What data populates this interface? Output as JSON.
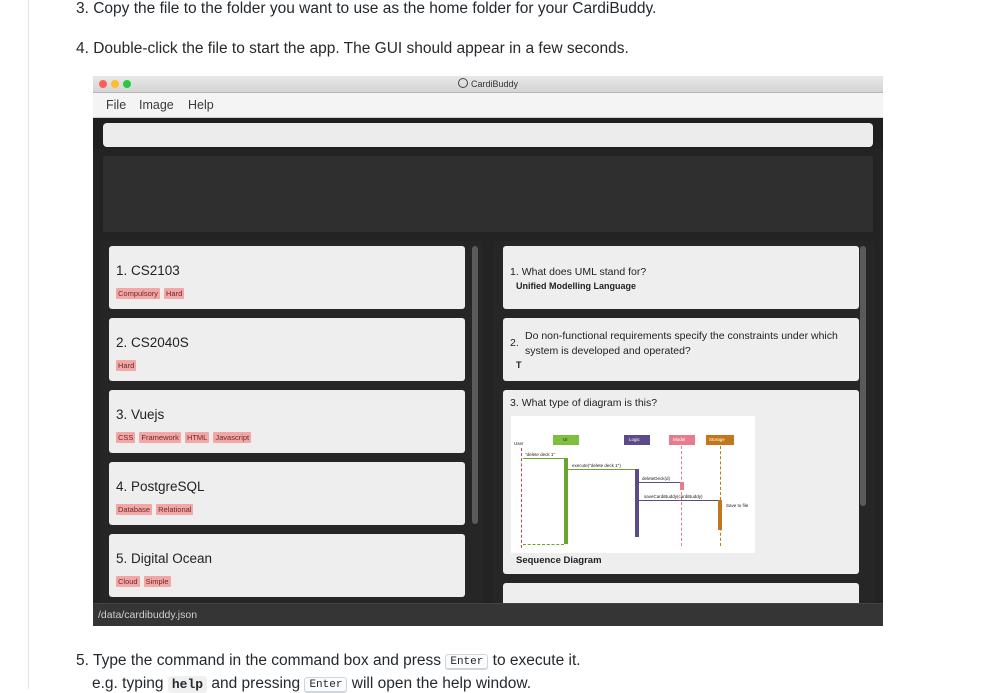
{
  "doc": {
    "step3": "3. Copy the file to the folder you want to use as the home folder for your CardiBuddy.",
    "step4": "4. Double-click the file to start the app. The GUI should appear in a few seconds.",
    "step5_prefix": "5. Type the command in the command box and press",
    "step5_key": "Enter",
    "step5_suffix": "to execute it.",
    "eg_prefix": "e.g. typing",
    "eg_code": "help",
    "eg_mid": "and pressing",
    "eg_key": "Enter",
    "eg_suffix": "will open the help window."
  },
  "app": {
    "window_title": "CardiBuddy",
    "menus": [
      "File",
      "Image",
      "Help"
    ],
    "decks": [
      {
        "name": "1. CS2103",
        "tags": [
          "Compulsory",
          "Hard"
        ]
      },
      {
        "name": "2. CS2040S",
        "tags": [
          "Hard"
        ]
      },
      {
        "name": "3. Vuejs",
        "tags": [
          "CSS",
          "Framework",
          "HTML",
          "Javascript"
        ]
      },
      {
        "name": "4. PostgreSQL",
        "tags": [
          "Database",
          "Relational"
        ]
      },
      {
        "name": "5. Digital Ocean",
        "tags": [
          "Cloud",
          "Simple"
        ]
      }
    ],
    "flashcards": [
      {
        "number": "1.",
        "question": "What does UML stand for?",
        "answer": "Unified Modelling Language"
      },
      {
        "number": "2.",
        "question_line1": "Do non-functional requirements specify the constraints under which",
        "question_line2": "system is developed and operated?",
        "answer": "T"
      },
      {
        "number": "3.",
        "question": "What type of diagram is this?",
        "answer": "Sequence Diagram"
      }
    ],
    "diagram_labels": {
      "user": "User",
      "ui": "UI",
      "logic": "Logic",
      "model": "Model",
      "storage": "Storage",
      "m1": "\"delete deck 1\"",
      "m2": "execute(\"delete deck 1\")",
      "m3": "deleteDeck(d)",
      "m4": "saveCardiBuddy(cardiBuddy)",
      "m5": "Save to file"
    },
    "status_path": "/data/cardibuddy.json"
  }
}
